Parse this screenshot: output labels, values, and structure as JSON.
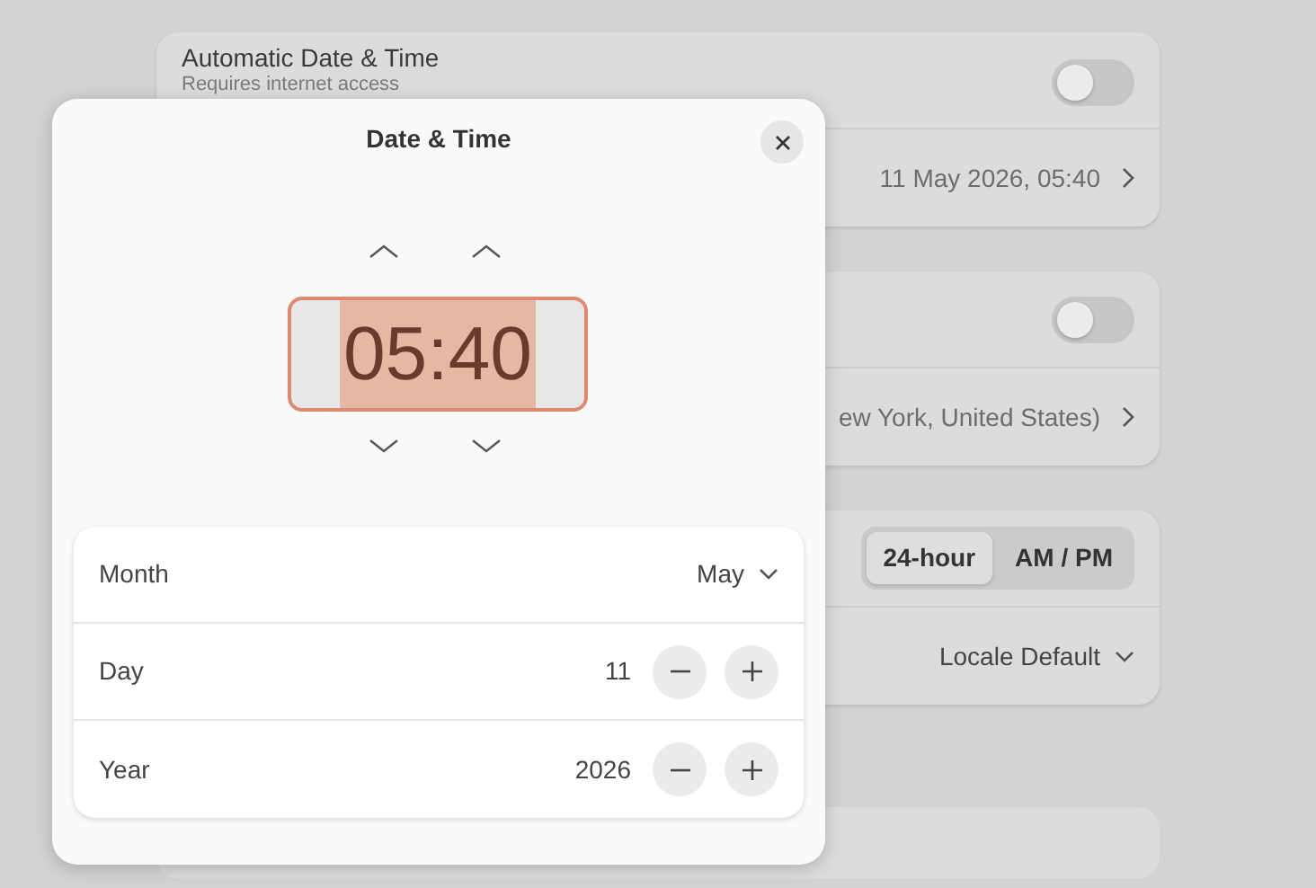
{
  "settings": {
    "cards": [
      {
        "rows": [
          {
            "kind": "toggle",
            "title": "Automatic Date & Time",
            "subtitle": "Requires internet access",
            "on": false
          },
          {
            "kind": "value",
            "value": "11 May 2026, 05:40"
          }
        ]
      },
      {
        "rows": [
          {
            "kind": "toggle",
            "on": false
          },
          {
            "kind": "value",
            "value": "ew York, United States)"
          }
        ]
      },
      {
        "rows": [
          {
            "kind": "segments",
            "segments": [
              {
                "label": "24-hour",
                "selected": true
              },
              {
                "label": "AM / PM",
                "selected": false
              }
            ]
          },
          {
            "kind": "dropdown",
            "value": "Locale Default"
          }
        ]
      }
    ]
  },
  "dialog": {
    "title": "Date & Time",
    "time": "05:40",
    "time_selected": true,
    "fields": [
      {
        "kind": "dropdown",
        "label": "Month",
        "value": "May"
      },
      {
        "kind": "spin",
        "label": "Day",
        "value": "11"
      },
      {
        "kind": "spin",
        "label": "Year",
        "value": "2026"
      }
    ]
  }
}
